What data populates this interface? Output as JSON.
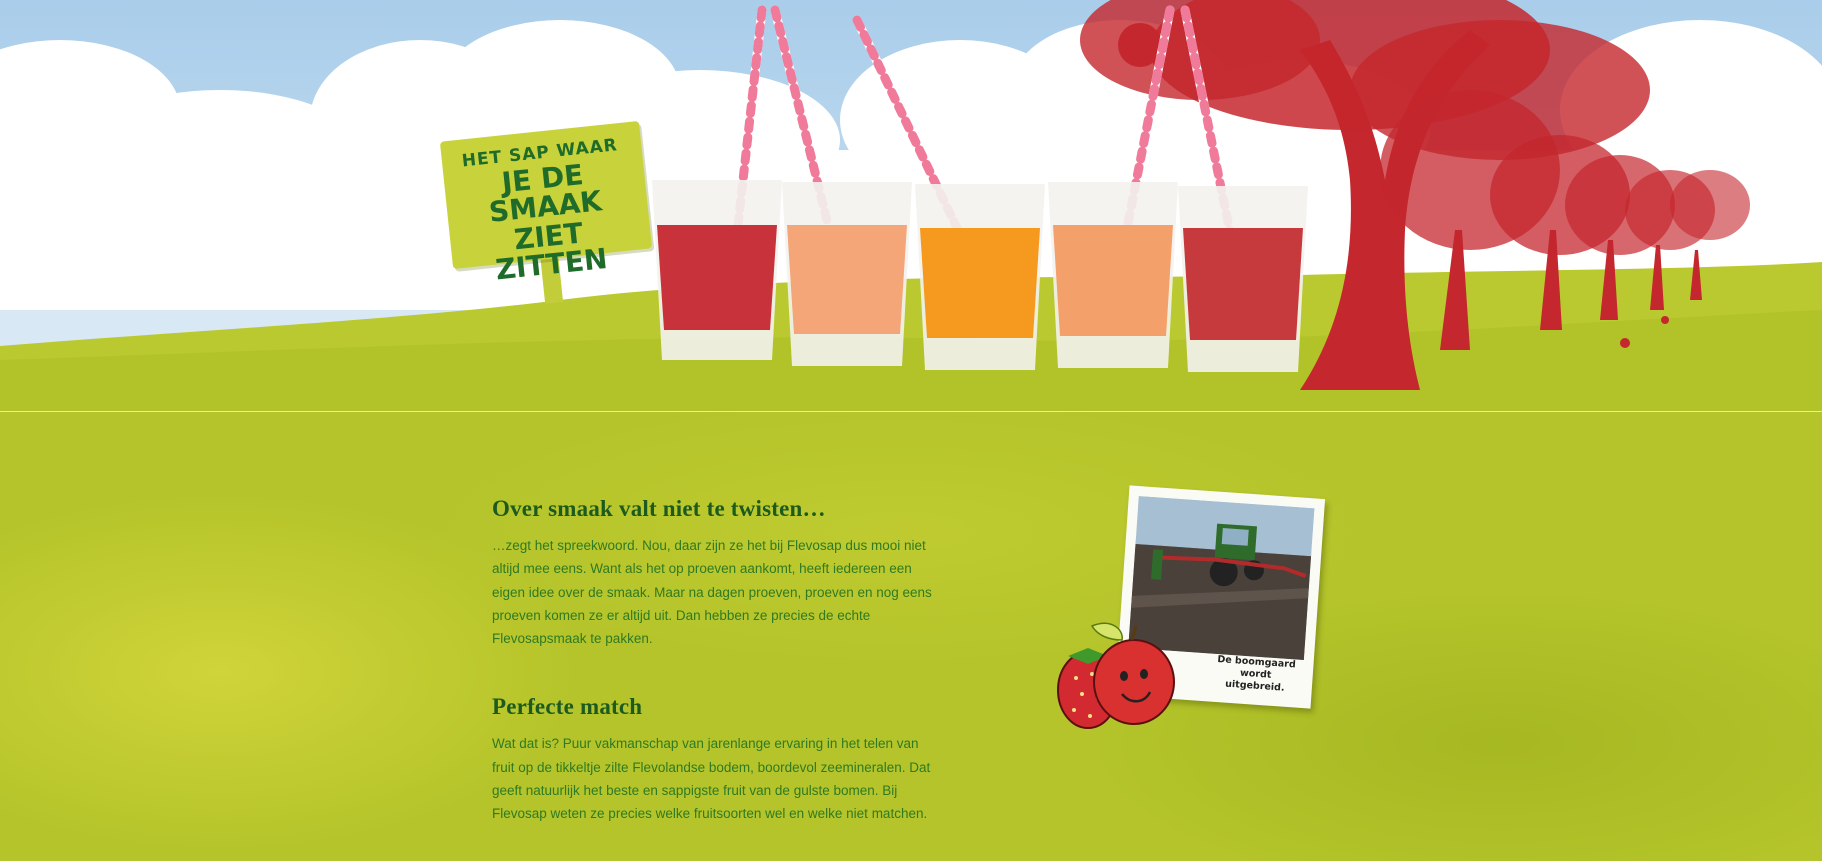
{
  "hero": {
    "sign": {
      "line1": "HET SAP WAAR",
      "line2": "JE DE SMAAK",
      "line3": "ZIET ZITTEN"
    },
    "juice_colors": [
      "#c8323a",
      "#f4a679",
      "#f59a1e",
      "#f3a06a",
      "#c63a3e"
    ],
    "tree_color": "#c4272d"
  },
  "content": {
    "section1": {
      "heading": "Over smaak valt niet te twisten…",
      "text": "…zegt het spreekwoord. Nou, daar zijn ze het bij Flevosap dus mooi niet altijd mee eens. Want als het op proeven aankomt, heeft iedereen een eigen idee over de smaak. Maar na dagen proeven, proeven en nog eens proeven komen ze er altijd uit. Dan hebben ze precies de echte Flevosapsmaak te pakken."
    },
    "section2": {
      "heading": "Perfecte match",
      "text": "Wat dat is? Puur vakmanschap van jarenlange ervaring in het telen van fruit op de tikkeltje zilte Flevolandse bodem, boordevol zeemineralen. Dat geeft natuurlijk het beste en sappigste fruit van de gulste bomen. Bij Flevosap weten ze precies welke fruitsoorten wel en welke niet matchen."
    },
    "polaroid": {
      "caption_line1": "De boomgaard",
      "caption_line2": "wordt uitgebreid."
    }
  },
  "colors": {
    "heading": "#1c5a1e",
    "text": "#2f7a23",
    "grass": "#b4c42a"
  }
}
